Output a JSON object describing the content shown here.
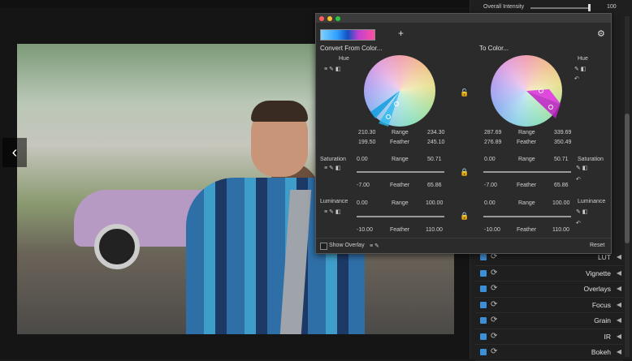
{
  "viewer": {
    "prev_arrow": "‹",
    "next_arrow": "›"
  },
  "panel_header": {
    "overall_intensity_label": "Overall Intensity",
    "overall_intensity_value": "100",
    "overall_intensity_fraction": 0.98
  },
  "color_panel": {
    "convert_from_label": "Convert From Color...",
    "to_color_label": "To Color...",
    "hue_label_left": "Hue",
    "hue_label_right": "Hue",
    "from": {
      "hue_a": "210.30",
      "range_label": "Range",
      "hue_b": "234.30",
      "hue_c": "199.50",
      "feather_label": "Feather",
      "hue_d": "245.10",
      "sat_label": "Saturation",
      "sat_a": "0.00",
      "sat_range_label": "Range",
      "sat_b": "50.71",
      "sat_c": "-7.00",
      "sat_feather_label": "Feather",
      "sat_d": "65.86",
      "lum_label": "Luminance",
      "lum_a": "0.00",
      "lum_range_label": "Range",
      "lum_b": "100.00",
      "lum_c": "-10.00",
      "lum_feather_label": "Feather",
      "lum_d": "110.00"
    },
    "to": {
      "hue_a": "287.69",
      "range_label": "Range",
      "hue_b": "339.69",
      "hue_c": "276.89",
      "feather_label": "Feather",
      "hue_d": "350.49",
      "sat_label": "Saturation",
      "sat_a": "0.00",
      "sat_range_label": "Range",
      "sat_b": "50.71",
      "sat_c": "-7.00",
      "sat_feather_label": "Feather",
      "sat_d": "65.86",
      "lum_label": "Luminance",
      "lum_a": "0.00",
      "lum_range_label": "Range",
      "lum_b": "100.00",
      "lum_c": "-10.00",
      "lum_feather_label": "Feather",
      "lum_d": "110.00"
    },
    "show_overlay_label": "Show Overlay",
    "reset_label": "Reset"
  },
  "effects": [
    {
      "label": "LUT"
    },
    {
      "label": "Vignette"
    },
    {
      "label": "Overlays"
    },
    {
      "label": "Focus"
    },
    {
      "label": "Grain"
    },
    {
      "label": "IR"
    },
    {
      "label": "Bokeh"
    }
  ],
  "colors": {
    "accent": "#3b8ed8",
    "panel_bg": "#2b2b2b",
    "selection_magenta": "#e040e0"
  }
}
